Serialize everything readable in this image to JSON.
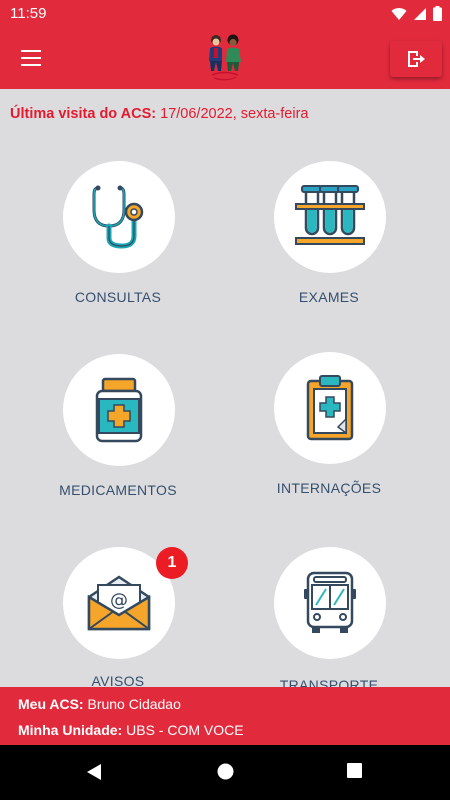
{
  "status_bar": {
    "time": "11:59",
    "icons": [
      "wifi-icon",
      "signal-icon",
      "battery-icon"
    ]
  },
  "app_bar": {
    "menu_icon": "hamburger-menu-icon",
    "logo": "com-voce-logo",
    "logout_icon": "logout-icon"
  },
  "last_visit": {
    "label": "Última visita do ACS:",
    "value": "17/06/2022, sexta-feira"
  },
  "menu": [
    {
      "label": "CONSULTAS",
      "icon": "stethoscope-icon"
    },
    {
      "label": "EXAMES",
      "icon": "test-tubes-icon"
    },
    {
      "label": "MEDICAMENTOS",
      "icon": "medicine-bottle-icon"
    },
    {
      "label": "INTERNAÇÕES",
      "icon": "clipboard-cross-icon"
    },
    {
      "label": "AVISOS",
      "icon": "envelope-icon",
      "badge": "1"
    },
    {
      "label": "TRANSPORTE",
      "icon": "bus-icon"
    }
  ],
  "footer": {
    "acs_label": "Meu ACS:",
    "acs_value": "Bruno Cidadao",
    "unit_label": "Minha Unidade:",
    "unit_value": "UBS - COM VOCE"
  },
  "nav": {
    "back_icon": "back-triangle-icon",
    "home_icon": "home-circle-icon",
    "recents_icon": "recents-square-icon"
  },
  "colors": {
    "brand": "#e12b3d",
    "label_text": "#35506f",
    "badge": "#ec1c24"
  }
}
